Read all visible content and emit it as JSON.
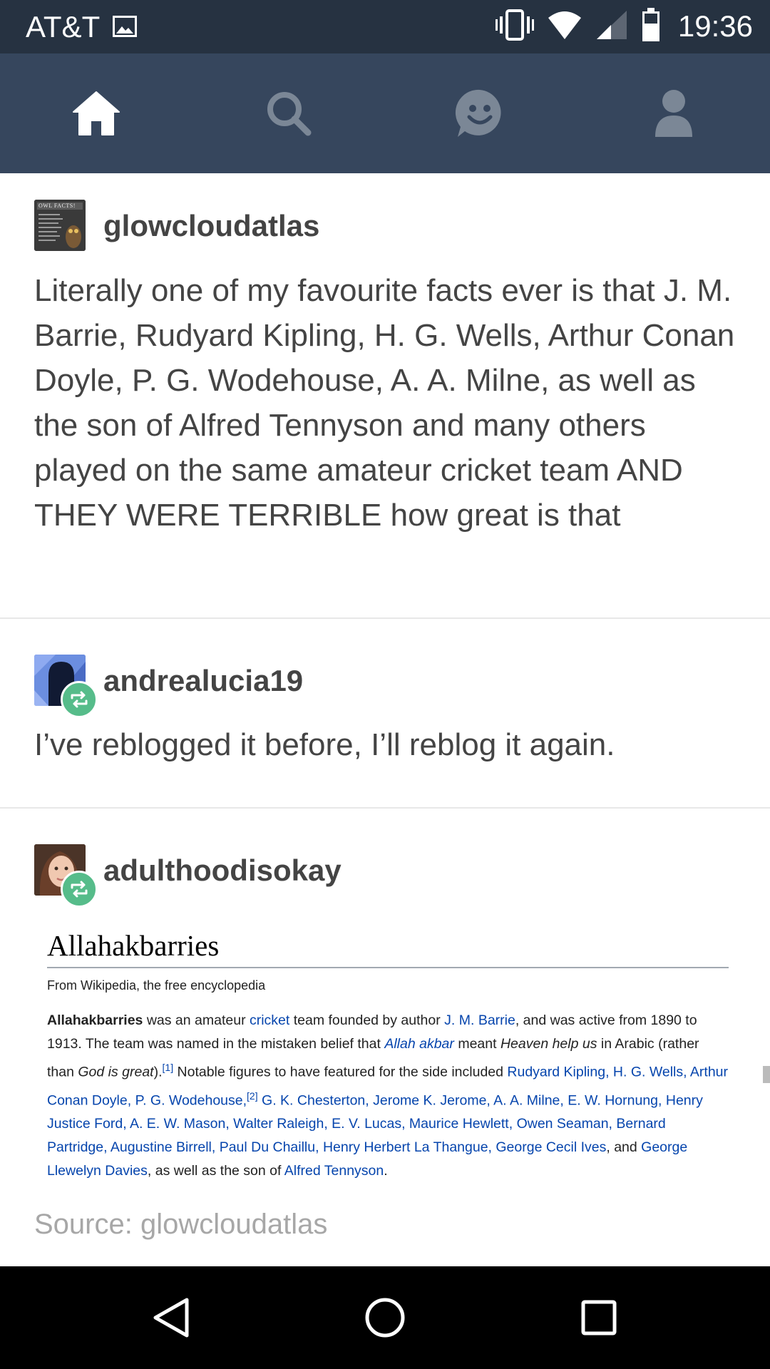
{
  "status_bar": {
    "carrier": "AT&T",
    "time": "19:36",
    "icons": [
      "image-notification-icon",
      "vibrate-icon",
      "wifi-icon",
      "cell-signal-icon",
      "battery-icon"
    ]
  },
  "nav": {
    "items": [
      "home-icon",
      "search-icon",
      "explore-icon",
      "account-icon"
    ],
    "active_color": "#ffffff",
    "inactive_color": "#7b8796"
  },
  "posts": [
    {
      "username": "glowcloudatlas",
      "avatar_caption": "OWL FACTS!",
      "text": "Literally one of my favourite facts ever is that J. M. Barrie, Rudyard Kipling, H. G. Wells, Arthur Conan Doyle, P. G. Wodehouse, A. A. Milne, as well as the son of Alfred Tennyson and many others played on the same amateur cricket team AND THEY WERE TERRIBLE how great is that"
    },
    {
      "username": "andrealucia19",
      "text": "I’ve reblogged it before, I’ll reblog it again."
    },
    {
      "username": "adulthoodisokay",
      "wiki": {
        "title": "Allahakbarries",
        "subtitle": "From Wikipedia, the free encyclopedia",
        "p_title": "Allahakbarries",
        "p1": " was an amateur ",
        "l_cricket": "cricket",
        "p2": " team founded by author ",
        "l_barrie": "J. M. Barrie",
        "p3": ", and was active from 1890 to 1913. The team was named in the mistaken belief that ",
        "l_allah": "Allah akbar",
        "p4": " meant ",
        "i_heaven": "Heaven help us",
        "p5": " in Arabic (rather than ",
        "i_god": "God is great",
        "p6": ").",
        "ref1": "[1]",
        "p7": " Notable figures to have featured for the side included ",
        "l_names1": "Rudyard Kipling, H. G. Wells, Arthur Conan Doyle, P. G. Wodehouse,",
        "ref2": "[2]",
        "l_names2": " G. K. Chesterton, Jerome K. Jerome, A. A. Milne, E. W. Hornung, Henry Justice Ford, A. E. W. Mason, Walter Raleigh, E. V. Lucas, Maurice Hewlett, Owen Seaman, Bernard Partridge, Augustine Birrell, Paul Du Chaillu, Henry Herbert La Thangue, George Cecil Ives",
        "p8": ", and ",
        "l_llewelyn": "George Llewelyn Davies",
        "p9": ", as well as the son of ",
        "l_tennyson": "Alfred Tennyson",
        "p10": "."
      }
    }
  ],
  "source": "Source: glowcloudatlas",
  "system_nav": [
    "back-icon",
    "home-circle-icon",
    "recents-icon"
  ],
  "colors": {
    "status_bar": "#263241",
    "nav_bar": "#36465d",
    "reblog_badge": "#56bc8a",
    "link": "#0645ad"
  }
}
